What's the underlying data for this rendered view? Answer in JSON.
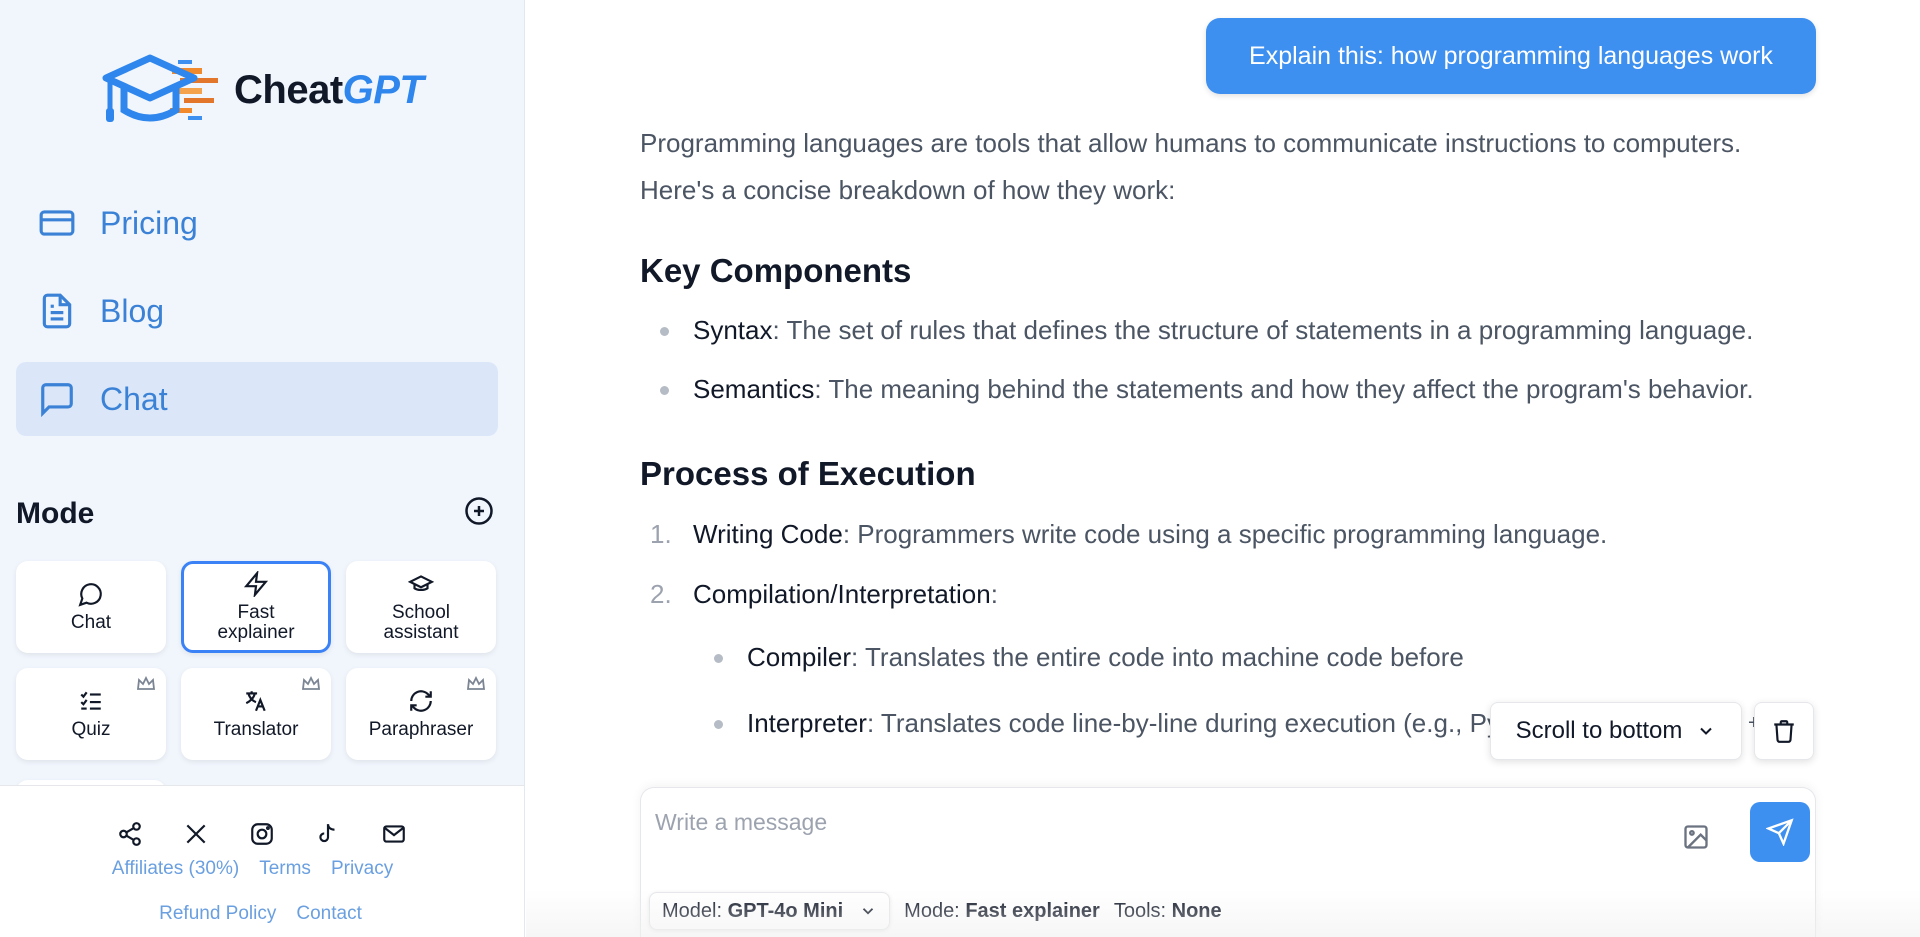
{
  "brand": {
    "name_main": "Cheat",
    "name_accent": "GPT"
  },
  "nav": {
    "items": [
      {
        "label": "Pricing",
        "icon": "credit-card-icon"
      },
      {
        "label": "Blog",
        "icon": "document-icon"
      },
      {
        "label": "Chat",
        "icon": "chat-bubble-icon",
        "active": true
      }
    ]
  },
  "mode": {
    "title": "Mode",
    "cards": [
      {
        "line1": "Chat",
        "line2": "",
        "icon": "chat-icon",
        "selected": false,
        "premium": false
      },
      {
        "line1": "Fast",
        "line2": "explainer",
        "icon": "lightning-icon",
        "selected": true,
        "premium": false
      },
      {
        "line1": "School",
        "line2": "assistant",
        "icon": "graduation-cap-icon",
        "selected": false,
        "premium": false
      },
      {
        "line1": "Quiz",
        "line2": "",
        "icon": "checklist-icon",
        "selected": false,
        "premium": true
      },
      {
        "line1": "Translator",
        "line2": "",
        "icon": "translate-icon",
        "selected": false,
        "premium": true
      },
      {
        "line1": "Paraphraser",
        "line2": "",
        "icon": "refresh-icon",
        "selected": false,
        "premium": true
      }
    ]
  },
  "footer": {
    "social_icons": [
      "share-icon",
      "x-icon",
      "instagram-icon",
      "tiktok-icon",
      "mail-icon"
    ],
    "links_row1": [
      "Affiliates (30%)",
      "Terms",
      "Privacy"
    ],
    "links_row2": [
      "Refund Policy",
      "Contact"
    ]
  },
  "conversation": {
    "user_message": "Explain this: how programming languages work",
    "intro_line1": "Programming languages are tools that allow humans to communicate instructions to computers.",
    "intro_line2": "Here's a concise breakdown of how they work:",
    "section1_title": "Key Components",
    "section1_items": [
      {
        "term": "Syntax",
        "text": ": The set of rules that defines the structure of statements in a programming language."
      },
      {
        "term": "Semantics",
        "text": ": The meaning behind the statements and how they affect the program's behavior."
      }
    ],
    "section2_title": "Process of Execution",
    "section2_items": [
      {
        "num": "1.",
        "term": "Writing Code",
        "text": ": Programmers write code using a specific programming language."
      },
      {
        "num": "2.",
        "term": "Compilation/Interpretation",
        "text": ":"
      }
    ],
    "section2_sub": [
      {
        "term": "Compiler",
        "text": ": Translates the entire code into machine code before"
      },
      {
        "term": "Interpreter",
        "text": ": Translates code line-by-line during execution (e.g., Python, JavaScript)."
      }
    ]
  },
  "controls": {
    "scroll_label": "Scroll to bottom",
    "plus": "+"
  },
  "composer": {
    "placeholder": "Write a message",
    "model_label": "Model:",
    "model_value": "GPT-4o Mini",
    "mode_label": "Mode:",
    "mode_value": "Fast explainer",
    "tools_label": "Tools:",
    "tools_value": "None"
  },
  "colors": {
    "accent": "#3d8ff0",
    "sidebar_bg": "#f1f6fd",
    "nav_active_bg": "#dbe7f9",
    "link": "#6a9fe0"
  }
}
